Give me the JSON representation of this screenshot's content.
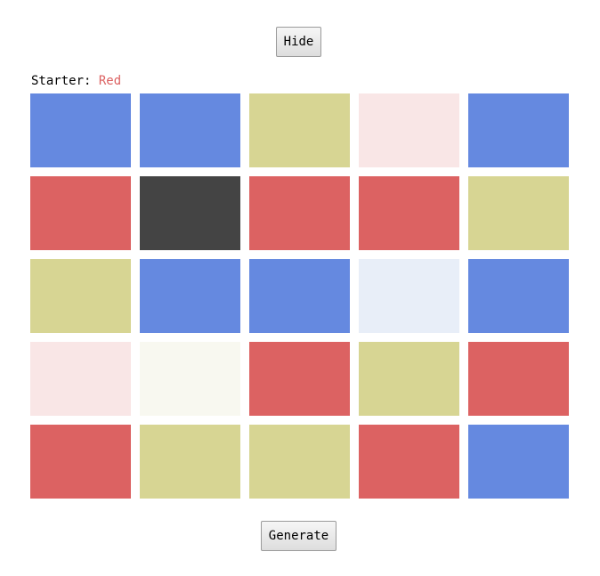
{
  "controls": {
    "hide_label": "Hide",
    "generate_label": "Generate"
  },
  "starter": {
    "label": "Starter: ",
    "value": "Red",
    "value_color": "#dc6262"
  },
  "colors": {
    "red": "#dc6262",
    "blue": "#6589e0",
    "neutral": "#d7d593",
    "assassin": "#444444",
    "red-revealed": "#f9e6e6",
    "blue-revealed": "#e8eef8",
    "neutral-revealed": "#f8f8f0"
  },
  "board": [
    [
      "blue",
      "blue",
      "neutral",
      "red-revealed",
      "blue"
    ],
    [
      "red",
      "assassin",
      "red",
      "red",
      "neutral"
    ],
    [
      "neutral",
      "blue",
      "blue",
      "blue-revealed",
      "blue"
    ],
    [
      "red-revealed",
      "neutral-revealed",
      "red",
      "neutral",
      "red"
    ],
    [
      "red",
      "neutral",
      "neutral",
      "red",
      "blue"
    ]
  ]
}
